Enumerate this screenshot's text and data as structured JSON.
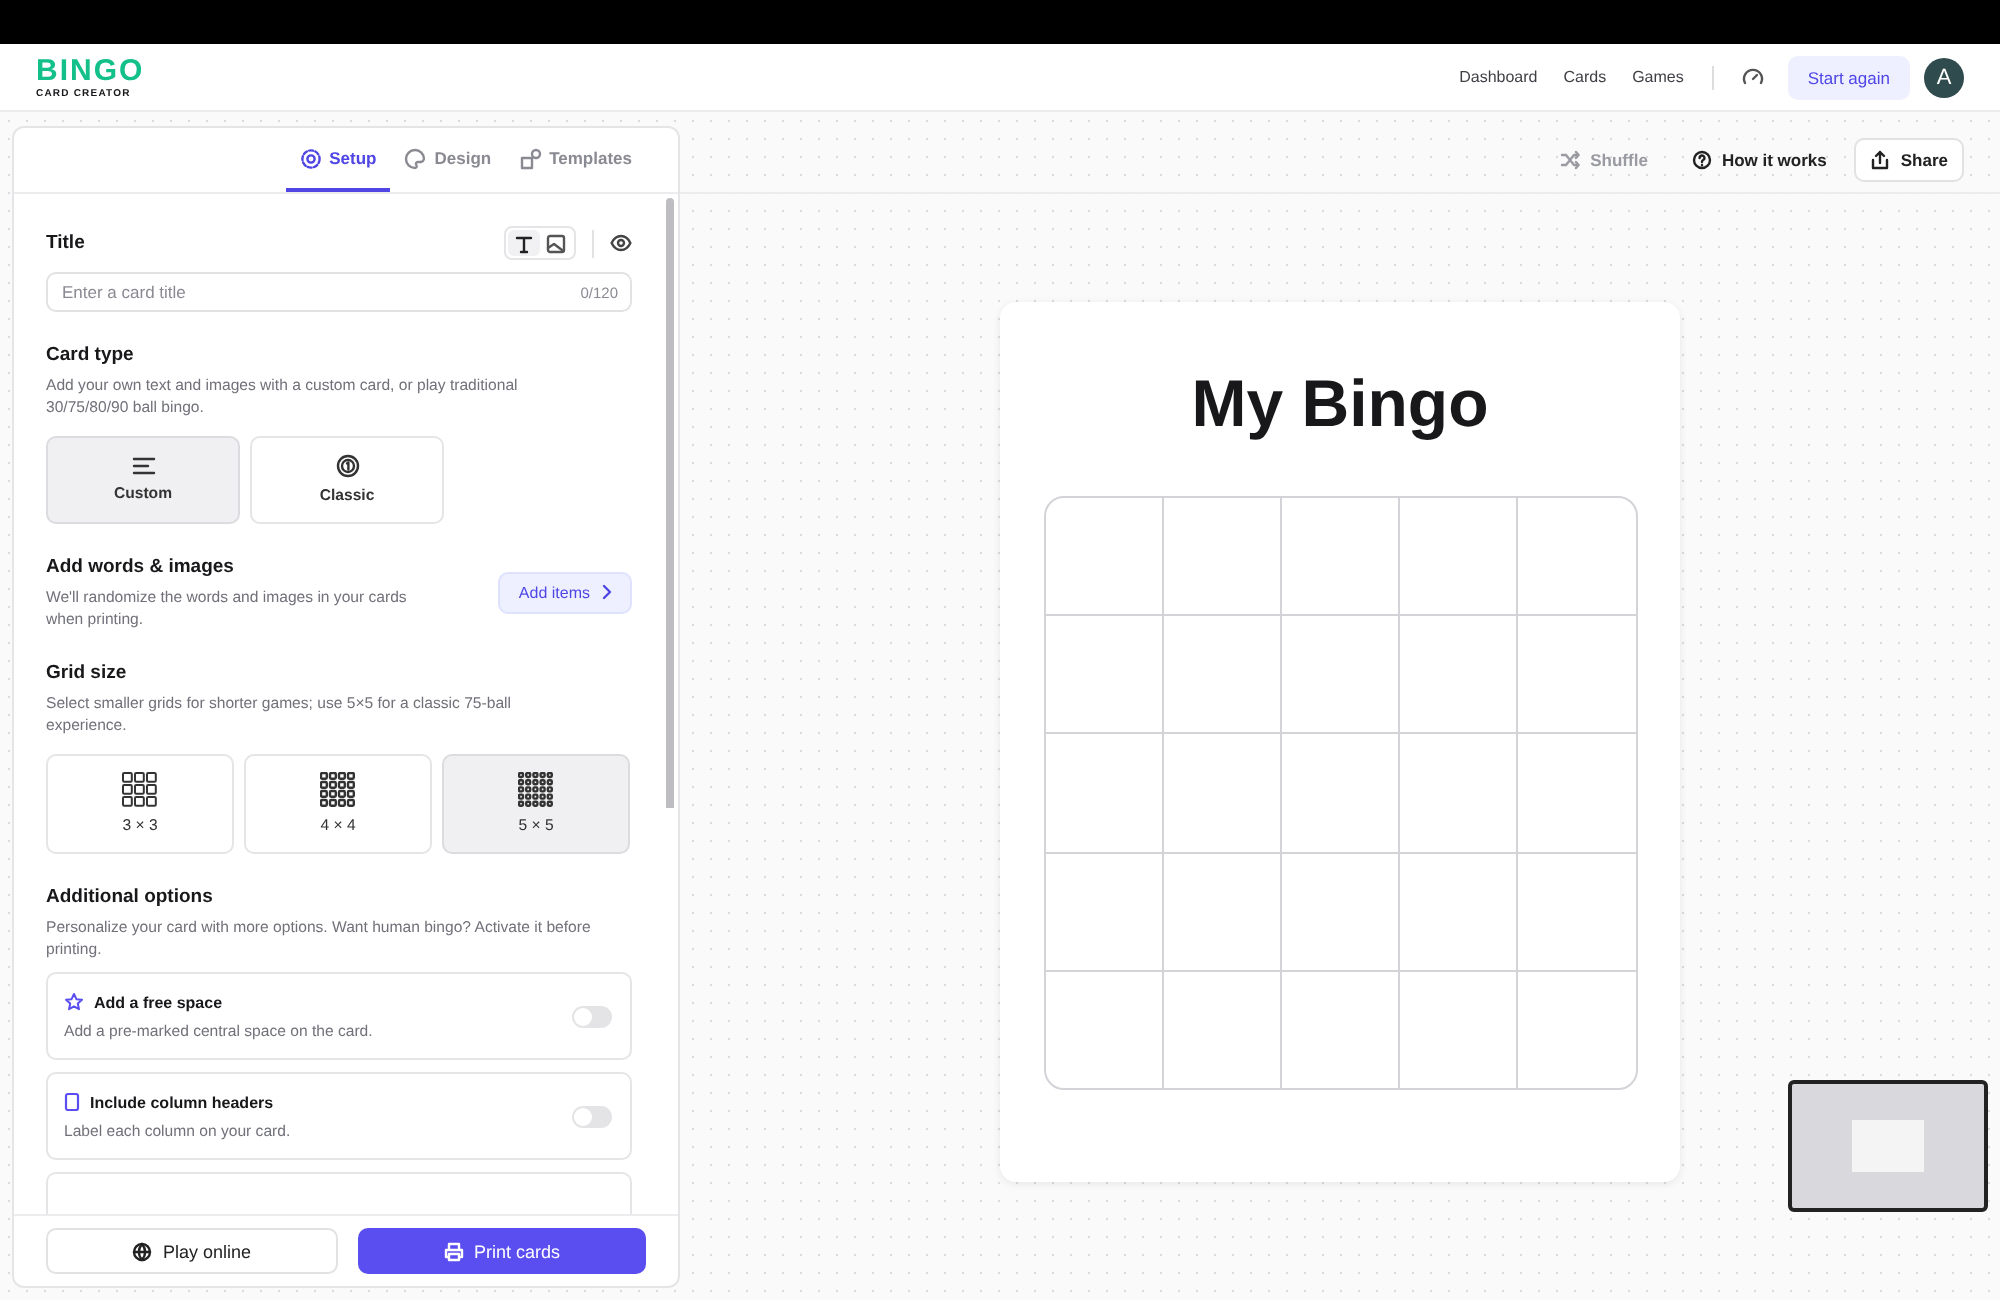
{
  "logo": {
    "title": "BINGO",
    "subtitle": "CARD CREATOR"
  },
  "nav": {
    "links": [
      "Dashboard",
      "Cards",
      "Games"
    ],
    "start_button": "Start again",
    "avatar": "A"
  },
  "panel": {
    "tabs": [
      {
        "label": "Setup",
        "kind": "gear",
        "selected": true
      },
      {
        "label": "Design",
        "kind": "palette",
        "selected": false
      },
      {
        "label": "Templates",
        "kind": "shapes",
        "selected": false
      }
    ],
    "title_section": {
      "heading": "Title",
      "modes": [
        {
          "kind": "text",
          "selected": true
        },
        {
          "kind": "image",
          "selected": false
        }
      ],
      "placeholder": "Enter a card title",
      "counter": "0/120"
    },
    "card_type": {
      "heading": "Card type",
      "description": "Add your own text and images with a custom card, or play traditional 30/75/80/90 ball bingo.",
      "options": [
        {
          "label": "Custom",
          "kind": "lines",
          "selected": true
        },
        {
          "label": "Classic",
          "kind": "ball",
          "selected": false
        }
      ]
    },
    "words": {
      "heading": "Add words & images",
      "description": "We'll randomize the words and images in your cards when printing.",
      "button": "Add items"
    },
    "grid_size": {
      "heading": "Grid size",
      "description": "Select smaller grids for shorter games; use 5×5 for a classic 75-ball experience.",
      "options": [
        {
          "label": "3 × 3",
          "kind": "small",
          "selected": false
        },
        {
          "label": "4 × 4",
          "kind": "medium",
          "selected": false
        },
        {
          "label": "5 × 5",
          "kind": "large",
          "selected": true
        }
      ]
    },
    "additional": {
      "heading": "Additional options",
      "description": "Personalize your card with more options. Want human bingo? Activate it before printing.",
      "items": [
        {
          "kind": "star",
          "title": "Add a free space",
          "description": "Add a pre-marked central space on the card.",
          "on": false
        },
        {
          "kind": "column",
          "title": "Include column headers",
          "description": "Label each column on your card.",
          "on": false
        }
      ]
    },
    "footer": {
      "play_button": "Play online",
      "print_button": "Print cards"
    }
  },
  "toolbar": {
    "shuffle": {
      "label": "Shuffle",
      "disabled": true
    },
    "help": "How it works",
    "share": "Share"
  },
  "card": {
    "title": "My Bingo"
  }
}
